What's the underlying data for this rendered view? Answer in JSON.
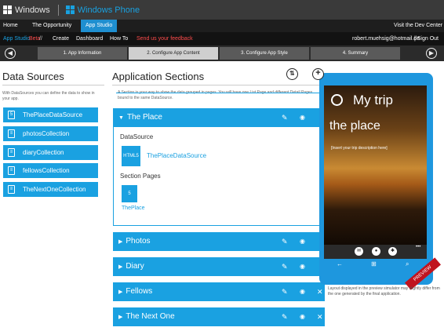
{
  "brand": {
    "windows": "Windows",
    "windows_phone": "Windows Phone"
  },
  "nav": {
    "home": "Home",
    "opportunity": "The Opportunity",
    "app_studio": "App Studio",
    "dev_center": "Visit the Dev Center"
  },
  "asbar": {
    "app_studio": "App Studio",
    "beta": "Beta",
    "slashes": "//",
    "create": "Create",
    "dashboard": "Dashboard",
    "howto": "How To",
    "feedback": "Send us your feedback",
    "user": "robert.muehsig@hotmail.de",
    "signout": "| Sign Out"
  },
  "steps": [
    "1. App Information",
    "2. Configure App Content",
    "3. Configure App Style",
    "4. Summary"
  ],
  "data_sources": {
    "title": "Data Sources",
    "description": "With DataSources you can define the data to show in your app.",
    "items": [
      "ThePlaceDataSource",
      "photosCollection",
      "diaryCollection",
      "fellowsCollection",
      "TheNextOneCollection"
    ]
  },
  "app_sections": {
    "title": "Application Sections",
    "description": "A Section is your way to show the data grouped in pages. You will have one List Page and different Detail Pages bound to the same DataSource.",
    "sections": [
      "The Place",
      "Photos",
      "Diary",
      "Fellows",
      "The Next One"
    ],
    "expanded": {
      "datasource_label": "DataSource",
      "datasource_name": "ThePlaceDataSource",
      "section_pages_label": "Section Pages",
      "page_name": "ThePlace"
    }
  },
  "phone": {
    "title": "My trip",
    "subtitle": "the place",
    "description": "[Insert your trip description here]",
    "ribbon": "PREVIEW"
  },
  "preview_note": "Layout displayed in the preview simulator may slightly differ from the one generated by the final application.",
  "colors": {
    "accent": "#1aa1e1",
    "nav_active": "#1f8fd0",
    "feedback": "#ff4b4b",
    "beta": "#ff4b4b",
    "ribbon": "#c0141f"
  }
}
